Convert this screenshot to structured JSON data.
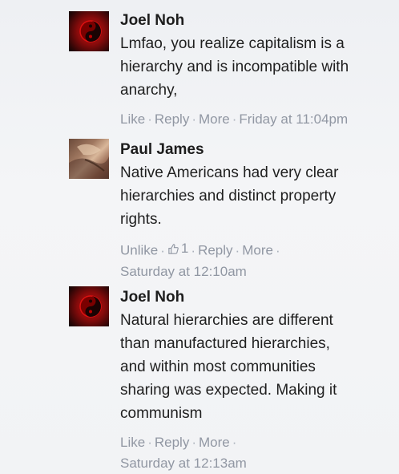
{
  "comments": [
    {
      "author": "Joel Noh",
      "lines": [
        "Lmfao, you realize capitalism is a",
        "hierarchy and is incompatible with",
        "anarchy,"
      ],
      "actions": {
        "like": "Like",
        "reply": "Reply",
        "more": "More",
        "timestamp": "Friday at 11:04pm"
      },
      "avatar": "red-yin-yang-avatar"
    },
    {
      "author": "Paul James",
      "lines": [
        "Native Americans had very clear",
        "hierarchies and distinct property",
        "rights."
      ],
      "actions": {
        "like": "Unlike",
        "like_count": "1",
        "reply": "Reply",
        "more": "More",
        "timestamp": "Saturday at 12:10am"
      },
      "avatar": "photo-avatar"
    },
    {
      "author": "Joel Noh",
      "lines": [
        "Natural hierarchies are different",
        "than manufactured hierarchies,",
        "and within most communities",
        "sharing was expected. Making it",
        "communism"
      ],
      "actions": {
        "like": "Like",
        "reply": "Reply",
        "more": "More",
        "timestamp": "Saturday at 12:13am"
      },
      "avatar": "red-yin-yang-avatar"
    }
  ],
  "colors": {
    "text": "#1f1f1f",
    "meta": "#9197a3",
    "background": "#f2f3f5"
  }
}
